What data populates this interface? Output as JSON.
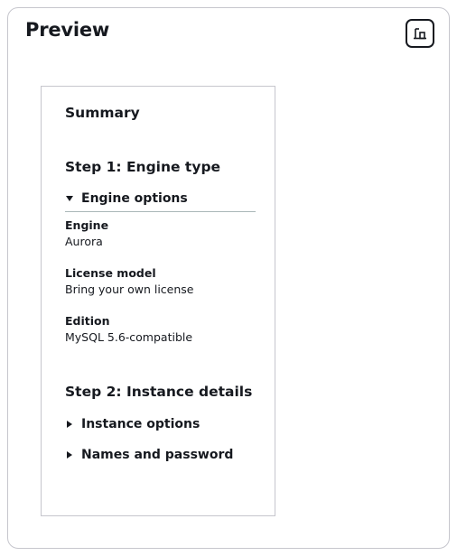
{
  "panel": {
    "title": "Preview",
    "action_icon": "preview-toggle-icon"
  },
  "summary": {
    "title": "Summary",
    "steps": [
      {
        "heading": "Step 1: Engine type",
        "sections": [
          {
            "label": "Engine options",
            "expanded": true,
            "items": [
              {
                "key": "Engine",
                "value": "Aurora"
              },
              {
                "key": "License model",
                "value": "Bring your own license"
              },
              {
                "key": "Edition",
                "value": "MySQL 5.6-compatible"
              }
            ]
          }
        ]
      },
      {
        "heading": "Step 2: Instance details",
        "sections": [
          {
            "label": "Instance options",
            "expanded": false
          },
          {
            "label": "Names and password",
            "expanded": false
          }
        ]
      }
    ]
  }
}
